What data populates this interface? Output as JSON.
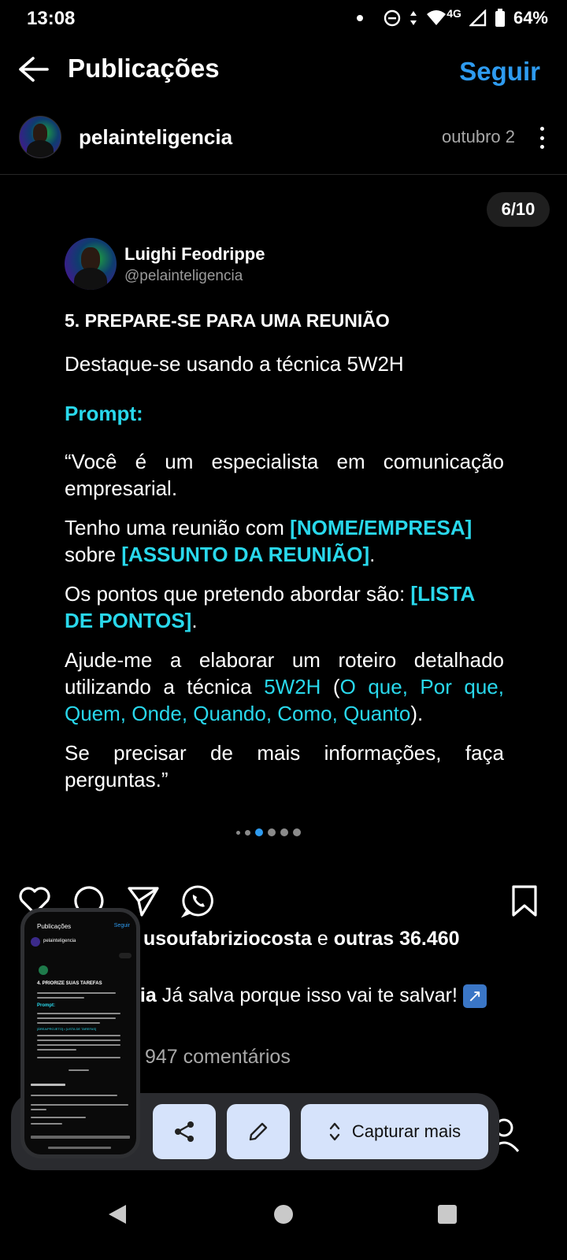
{
  "status_bar": {
    "time": "13:08",
    "network": "4G",
    "battery": "64%"
  },
  "header": {
    "title": "Publicações",
    "follow_label": "Seguir"
  },
  "post": {
    "author": "pelainteligencia",
    "date": "outubro 2"
  },
  "slide": {
    "counter": "6/10",
    "author_name": "Luighi Feodrippe",
    "author_handle": "@pelainteligencia",
    "heading": "5. PREPARE-SE PARA UMA REUNIÃO",
    "subheading": "Destaque-se usando a técnica 5W2H",
    "prompt_label": "Prompt:",
    "p1": "“Você é um especialista em comunicação empresarial.",
    "p2_a": "Tenho uma reunião com ",
    "p2_b": "[NOME/EMPRESA]",
    "p2_c": " sobre ",
    "p2_d": "[ASSUNTO DA REUNIÃO]",
    "p2_e": ".",
    "p3_a": "Os pontos que pretendo abordar são: ",
    "p3_b": "[LISTA DE PONTOS]",
    "p3_c": ".",
    "p4_a": "Ajude-me a elaborar um roteiro detalhado utilizando a técnica ",
    "p4_b": "5W2H",
    "p4_c": " (",
    "p4_d": "O que, Por que, Quem, Onde, Quando, Como, Quanto",
    "p4_e": ").",
    "p5": "Se precisar de mais informações, faça perguntas.”"
  },
  "engagement": {
    "likes_user": "usoufabriziocosta",
    "likes_connector": " e ",
    "likes_others": "outras 36.460",
    "caption_user_fragment": "cia",
    "caption_text": " Já salva porque isso vai te salvar!",
    "comments": "947 comentários"
  },
  "screenshot_toolbar": {
    "capture_more_label": "Capturar mais"
  },
  "thumbnail": {
    "title": "Publicações",
    "follow": "Seguir",
    "author": "pelainteligencia",
    "heading": "4. PRIORIZE SUAS TAREFAS",
    "prompt": "Prompt:",
    "placeholder": "[ÁREA/PROJETO] • [LISTA DE TAREFAS]"
  },
  "colors": {
    "accent_blue": "#2e9bf0",
    "highlight_cyan": "#29d8ec",
    "toolbar_bg": "#2a2b2f",
    "toolbar_button": "#d6e3fb"
  }
}
